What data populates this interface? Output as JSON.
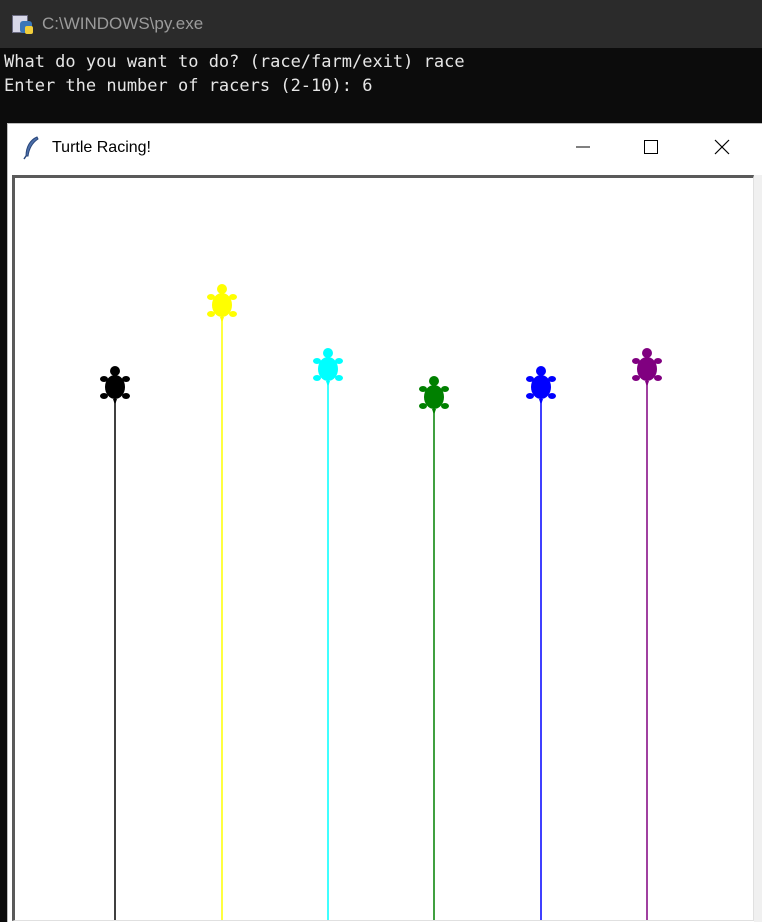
{
  "console": {
    "title": "C:\\WINDOWS\\py.exe",
    "lines": [
      "What do you want to do? (race/farm/exit) race",
      "Enter the number of racers (2-10): 6"
    ]
  },
  "turtle_window": {
    "title": "Turtle Racing!",
    "controls": {
      "minimize": "minimize-icon",
      "maximize": "maximize-icon",
      "close": "close-icon"
    }
  },
  "race": {
    "racer_count": 6,
    "racers": [
      {
        "color": "#000000"
      },
      {
        "color": "#ffff00"
      },
      {
        "color": "#00ffff"
      },
      {
        "color": "#008000"
      },
      {
        "color": "#0000ff"
      },
      {
        "color": "#800080"
      }
    ]
  }
}
